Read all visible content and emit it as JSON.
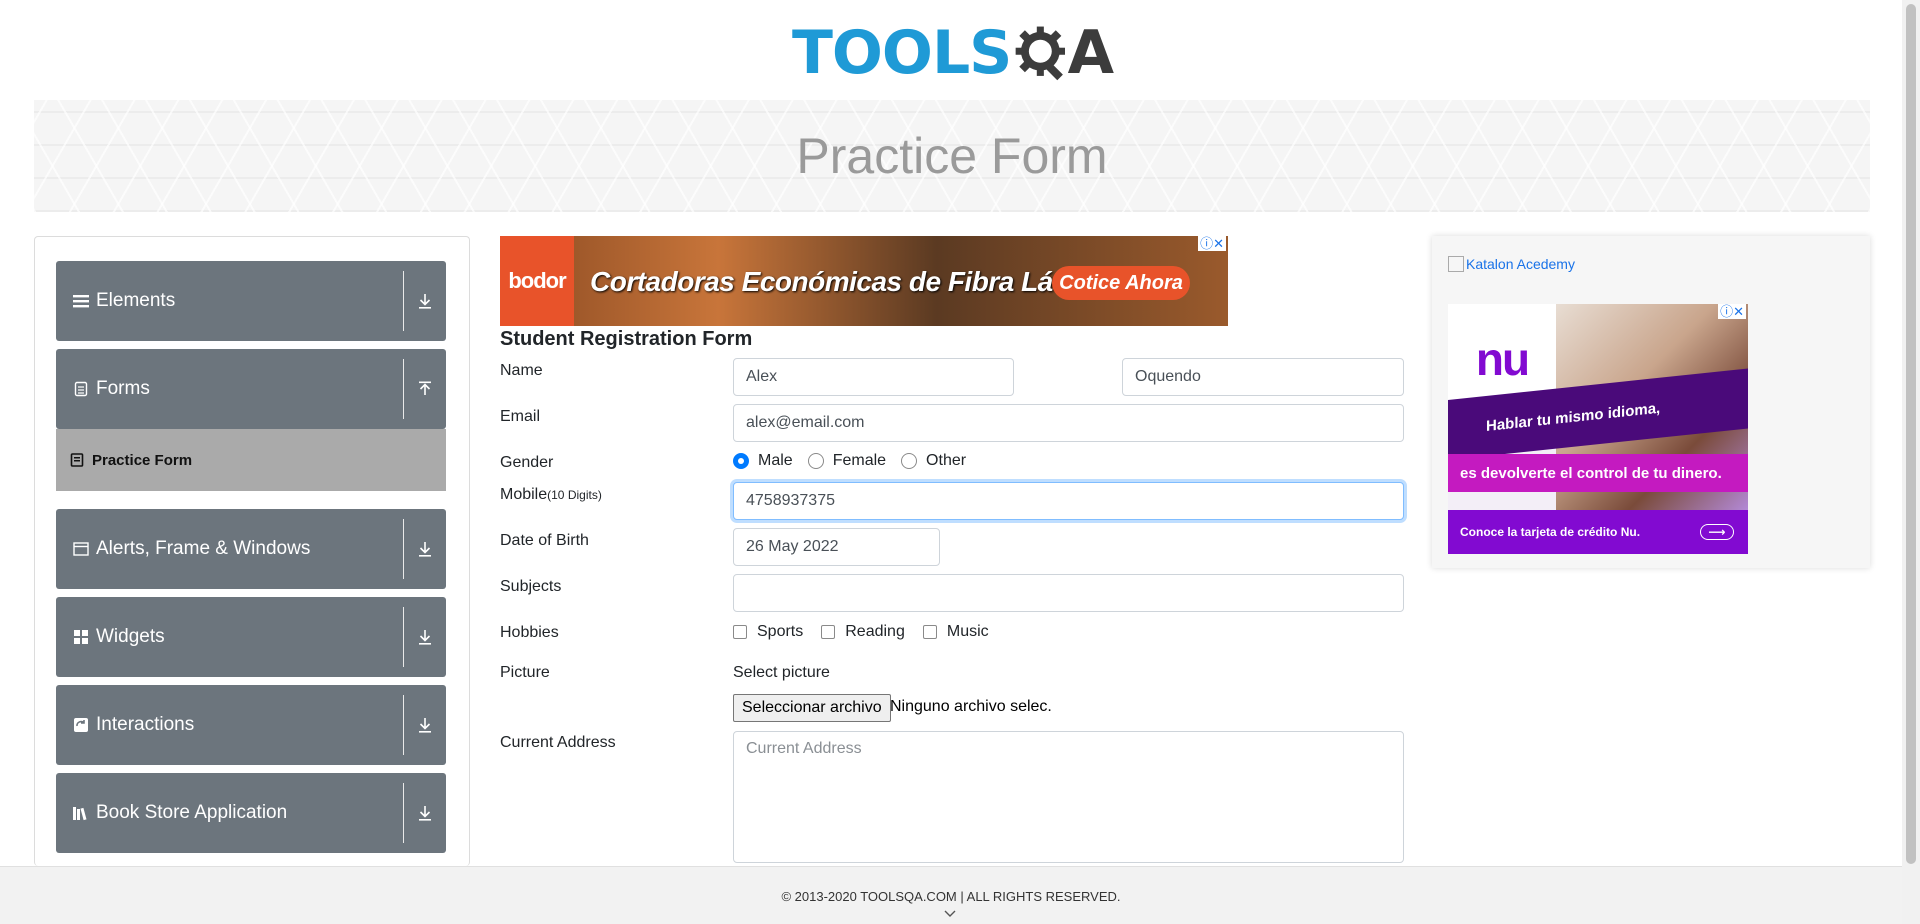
{
  "header": {
    "logo_text": "TOOLS",
    "logo_text_end": "A",
    "brand_color": "#1f9ad6"
  },
  "banner": {
    "title": "Practice Form"
  },
  "sidebar": {
    "groups": [
      {
        "label": "Elements",
        "icon": "hamburger-icon",
        "state": "collapsed"
      },
      {
        "label": "Forms",
        "icon": "document-icon",
        "state": "expanded"
      },
      {
        "label": "Alerts, Frame & Windows",
        "icon": "window-icon",
        "state": "collapsed"
      },
      {
        "label": "Widgets",
        "icon": "grid-icon",
        "state": "collapsed"
      },
      {
        "label": "Interactions",
        "icon": "interaction-icon",
        "state": "collapsed"
      },
      {
        "label": "Book Store Application",
        "icon": "books-icon",
        "state": "collapsed"
      }
    ],
    "active_item": {
      "label": "Practice Form",
      "icon": "form-icon"
    }
  },
  "ad_top": {
    "brand": "bodor",
    "headline": "Cortadoras Económicas de Fibra Láser",
    "cta": "Cotice Ahora",
    "ad_choices": "ⓘ✕"
  },
  "form": {
    "title": "Student Registration Form",
    "name_label": "Name",
    "first_name": "Alex",
    "last_name": "Oquendo",
    "email_label": "Email",
    "email": "alex@email.com",
    "gender_label": "Gender",
    "gender_options": [
      "Male",
      "Female",
      "Other"
    ],
    "gender_selected": "Male",
    "mobile_label": "Mobile",
    "mobile_hint": "(10 Digits)",
    "mobile": "4758937375",
    "dob_label": "Date of Birth",
    "dob": "26 May 2022",
    "subjects_label": "Subjects",
    "subjects": "",
    "hobbies_label": "Hobbies",
    "hobbies": [
      "Sports",
      "Reading",
      "Music"
    ],
    "picture_label": "Picture",
    "select_picture": "Select picture",
    "file_button": "Seleccionar archivo",
    "file_status": "Ninguno archivo selec.",
    "address_label": "Current Address",
    "address_placeholder": "Current Address"
  },
  "ad_right": {
    "alt_text": "Katalon Acedemy",
    "nu_logo": "nu",
    "line1": "Hablar tu mismo idioma,",
    "line2": "es devolverte el control de tu dinero.",
    "line3": "Conoce la tarjeta de crédito Nu.",
    "arrow": "⟶",
    "ad_choices": "ⓘ✕"
  },
  "footer": {
    "copyright": "© 2013-2020 TOOLSQA.COM | ALL RIGHTS RESERVED."
  }
}
